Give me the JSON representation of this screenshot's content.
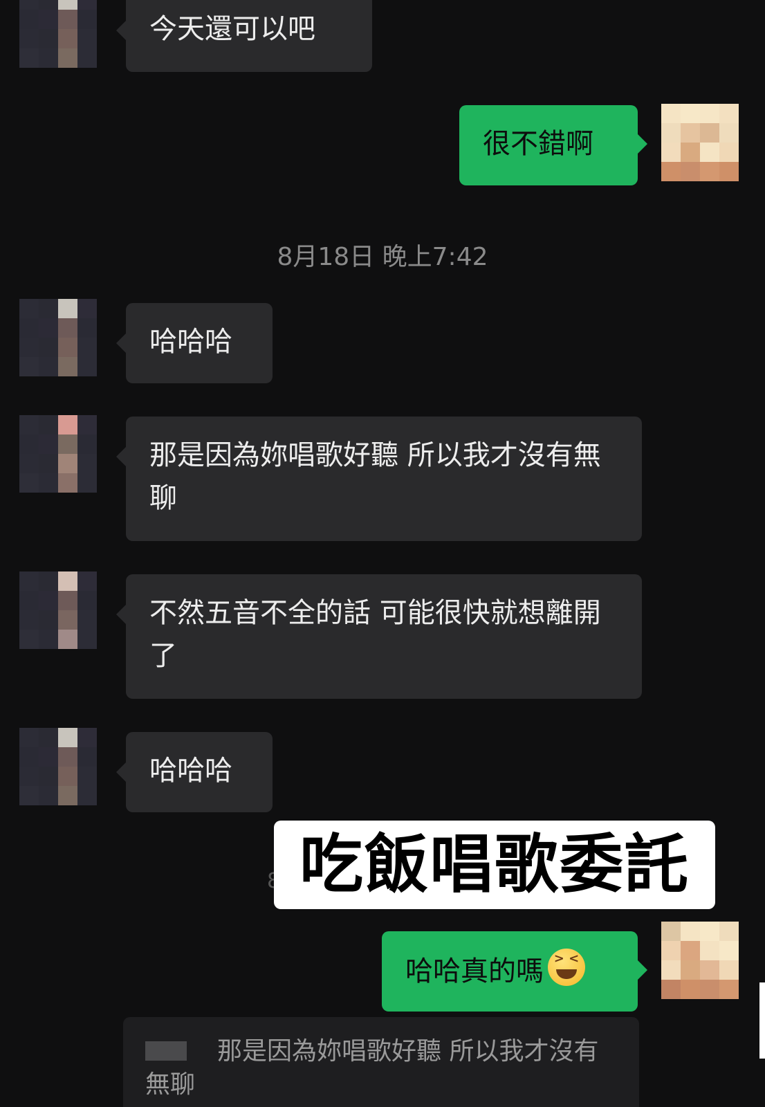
{
  "messages": [
    {
      "side": "in",
      "text": "今天還可以吧"
    },
    {
      "side": "out",
      "text": "很不錯啊"
    },
    {
      "side": "in",
      "text": "哈哈哈"
    },
    {
      "side": "in",
      "text": "那是因為妳唱歌好聽 所以我才沒有無聊"
    },
    {
      "side": "in",
      "text": "不然五音不全的話 可能很快就想離開了"
    },
    {
      "side": "in",
      "text": "哈哈哈"
    },
    {
      "side": "out",
      "text": "哈哈真的嗎",
      "emoji": "laughing-emoji"
    }
  ],
  "timestamp": "8月18日 晚上7:42",
  "overlay_label": "吃飯唱歌委託",
  "timestamp_fragment": "8",
  "quote": {
    "text": "那是因為妳唱歌好聽 所以我才沒有無聊"
  },
  "colors": {
    "background": "#0f0f10",
    "incoming_bubble": "#2a2a2c",
    "outgoing_bubble": "#1fb45d",
    "timestamp": "#8a8a8a"
  }
}
